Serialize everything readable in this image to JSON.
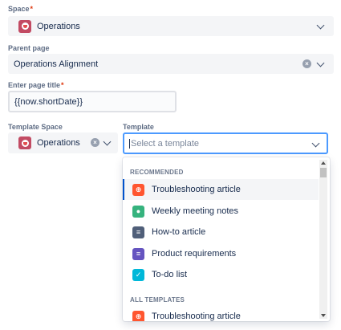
{
  "space": {
    "label": "Space",
    "required_mark": "*",
    "value": "Operations",
    "icon": "space-avatar-icon"
  },
  "parent_page": {
    "label": "Parent page",
    "value": "Operations Alignment"
  },
  "page_title": {
    "label": "Enter page title",
    "required_mark": "*",
    "value": "{{now.shortDate}}"
  },
  "template_space": {
    "label": "Template Space",
    "value": "Operations"
  },
  "template": {
    "label": "Template",
    "placeholder": "Select a template"
  },
  "menu": {
    "groups": [
      {
        "title": "RECOMMENDED",
        "options": [
          {
            "label": "Troubleshooting article",
            "icon": "troubleshooting-icon",
            "color": "#ff5630"
          },
          {
            "label": "Weekly meeting notes",
            "icon": "meeting-notes-icon",
            "color": "#36b37e"
          },
          {
            "label": "How-to article",
            "icon": "how-to-icon",
            "color": "#505f79"
          },
          {
            "label": "Product requirements",
            "icon": "requirements-icon",
            "color": "#6554c0"
          },
          {
            "label": "To-do list",
            "icon": "todo-icon",
            "color": "#00b8d9"
          }
        ]
      },
      {
        "title": "ALL TEMPLATES",
        "options": [
          {
            "label": "Troubleshooting article",
            "icon": "troubleshooting-icon",
            "color": "#ff5630"
          }
        ]
      }
    ]
  },
  "colors": {
    "focus_border": "#4c9aff",
    "selected_indicator": "#0052cc",
    "required": "#de350b"
  }
}
